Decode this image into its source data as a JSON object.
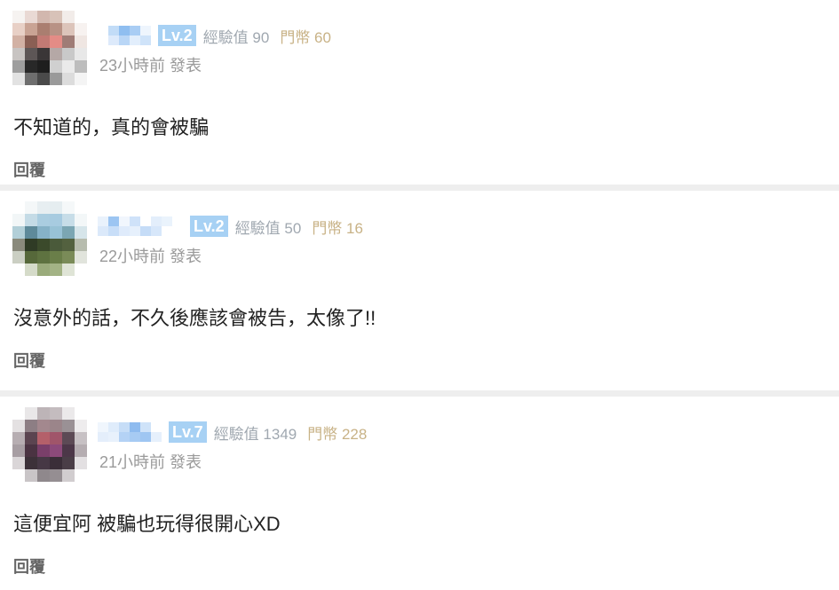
{
  "comments": [
    {
      "level": "Lv.2",
      "exp": "經驗值 90",
      "coins": "門幣 60",
      "time": "23小時前 發表",
      "text": "不知道的，真的會被騙",
      "reply_label": "回覆"
    },
    {
      "level": "Lv.2",
      "exp": "經驗值 50",
      "coins": "門幣 16",
      "time": "22小時前 發表",
      "text": "沒意外的話，不久後應該會被告，太像了!!",
      "reply_label": "回覆"
    },
    {
      "level": "Lv.7",
      "exp": "經驗值 1349",
      "coins": "門幣 228",
      "time": "21小時前 發表",
      "text": "這便宜阿 被騙也玩得很開心XD",
      "reply_label": "回覆"
    }
  ],
  "colors": {
    "level_badge": "#a7d1f4",
    "exp_text": "#a0a8b0",
    "coin_text": "#c8b286",
    "divider": "#eeeeee"
  }
}
